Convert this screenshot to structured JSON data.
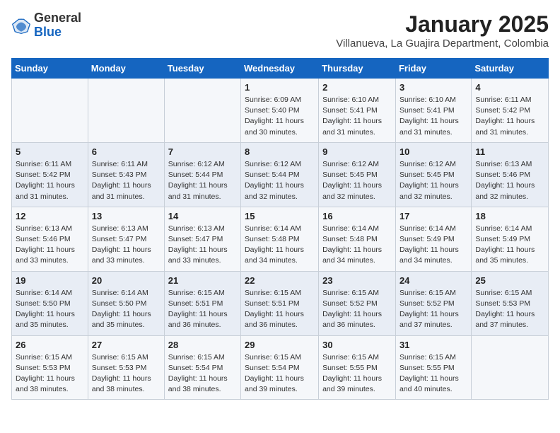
{
  "header": {
    "logo_general": "General",
    "logo_blue": "Blue",
    "title": "January 2025",
    "subtitle": "Villanueva, La Guajira Department, Colombia"
  },
  "weekdays": [
    "Sunday",
    "Monday",
    "Tuesday",
    "Wednesday",
    "Thursday",
    "Friday",
    "Saturday"
  ],
  "weeks": [
    [
      {
        "day": "",
        "info": ""
      },
      {
        "day": "",
        "info": ""
      },
      {
        "day": "",
        "info": ""
      },
      {
        "day": "1",
        "info": "Sunrise: 6:09 AM\nSunset: 5:40 PM\nDaylight: 11 hours\nand 30 minutes."
      },
      {
        "day": "2",
        "info": "Sunrise: 6:10 AM\nSunset: 5:41 PM\nDaylight: 11 hours\nand 31 minutes."
      },
      {
        "day": "3",
        "info": "Sunrise: 6:10 AM\nSunset: 5:41 PM\nDaylight: 11 hours\nand 31 minutes."
      },
      {
        "day": "4",
        "info": "Sunrise: 6:11 AM\nSunset: 5:42 PM\nDaylight: 11 hours\nand 31 minutes."
      }
    ],
    [
      {
        "day": "5",
        "info": "Sunrise: 6:11 AM\nSunset: 5:42 PM\nDaylight: 11 hours\nand 31 minutes."
      },
      {
        "day": "6",
        "info": "Sunrise: 6:11 AM\nSunset: 5:43 PM\nDaylight: 11 hours\nand 31 minutes."
      },
      {
        "day": "7",
        "info": "Sunrise: 6:12 AM\nSunset: 5:44 PM\nDaylight: 11 hours\nand 31 minutes."
      },
      {
        "day": "8",
        "info": "Sunrise: 6:12 AM\nSunset: 5:44 PM\nDaylight: 11 hours\nand 32 minutes."
      },
      {
        "day": "9",
        "info": "Sunrise: 6:12 AM\nSunset: 5:45 PM\nDaylight: 11 hours\nand 32 minutes."
      },
      {
        "day": "10",
        "info": "Sunrise: 6:12 AM\nSunset: 5:45 PM\nDaylight: 11 hours\nand 32 minutes."
      },
      {
        "day": "11",
        "info": "Sunrise: 6:13 AM\nSunset: 5:46 PM\nDaylight: 11 hours\nand 32 minutes."
      }
    ],
    [
      {
        "day": "12",
        "info": "Sunrise: 6:13 AM\nSunset: 5:46 PM\nDaylight: 11 hours\nand 33 minutes."
      },
      {
        "day": "13",
        "info": "Sunrise: 6:13 AM\nSunset: 5:47 PM\nDaylight: 11 hours\nand 33 minutes."
      },
      {
        "day": "14",
        "info": "Sunrise: 6:13 AM\nSunset: 5:47 PM\nDaylight: 11 hours\nand 33 minutes."
      },
      {
        "day": "15",
        "info": "Sunrise: 6:14 AM\nSunset: 5:48 PM\nDaylight: 11 hours\nand 34 minutes."
      },
      {
        "day": "16",
        "info": "Sunrise: 6:14 AM\nSunset: 5:48 PM\nDaylight: 11 hours\nand 34 minutes."
      },
      {
        "day": "17",
        "info": "Sunrise: 6:14 AM\nSunset: 5:49 PM\nDaylight: 11 hours\nand 34 minutes."
      },
      {
        "day": "18",
        "info": "Sunrise: 6:14 AM\nSunset: 5:49 PM\nDaylight: 11 hours\nand 35 minutes."
      }
    ],
    [
      {
        "day": "19",
        "info": "Sunrise: 6:14 AM\nSunset: 5:50 PM\nDaylight: 11 hours\nand 35 minutes."
      },
      {
        "day": "20",
        "info": "Sunrise: 6:14 AM\nSunset: 5:50 PM\nDaylight: 11 hours\nand 35 minutes."
      },
      {
        "day": "21",
        "info": "Sunrise: 6:15 AM\nSunset: 5:51 PM\nDaylight: 11 hours\nand 36 minutes."
      },
      {
        "day": "22",
        "info": "Sunrise: 6:15 AM\nSunset: 5:51 PM\nDaylight: 11 hours\nand 36 minutes."
      },
      {
        "day": "23",
        "info": "Sunrise: 6:15 AM\nSunset: 5:52 PM\nDaylight: 11 hours\nand 36 minutes."
      },
      {
        "day": "24",
        "info": "Sunrise: 6:15 AM\nSunset: 5:52 PM\nDaylight: 11 hours\nand 37 minutes."
      },
      {
        "day": "25",
        "info": "Sunrise: 6:15 AM\nSunset: 5:53 PM\nDaylight: 11 hours\nand 37 minutes."
      }
    ],
    [
      {
        "day": "26",
        "info": "Sunrise: 6:15 AM\nSunset: 5:53 PM\nDaylight: 11 hours\nand 38 minutes."
      },
      {
        "day": "27",
        "info": "Sunrise: 6:15 AM\nSunset: 5:53 PM\nDaylight: 11 hours\nand 38 minutes."
      },
      {
        "day": "28",
        "info": "Sunrise: 6:15 AM\nSunset: 5:54 PM\nDaylight: 11 hours\nand 38 minutes."
      },
      {
        "day": "29",
        "info": "Sunrise: 6:15 AM\nSunset: 5:54 PM\nDaylight: 11 hours\nand 39 minutes."
      },
      {
        "day": "30",
        "info": "Sunrise: 6:15 AM\nSunset: 5:55 PM\nDaylight: 11 hours\nand 39 minutes."
      },
      {
        "day": "31",
        "info": "Sunrise: 6:15 AM\nSunset: 5:55 PM\nDaylight: 11 hours\nand 40 minutes."
      },
      {
        "day": "",
        "info": ""
      }
    ]
  ]
}
